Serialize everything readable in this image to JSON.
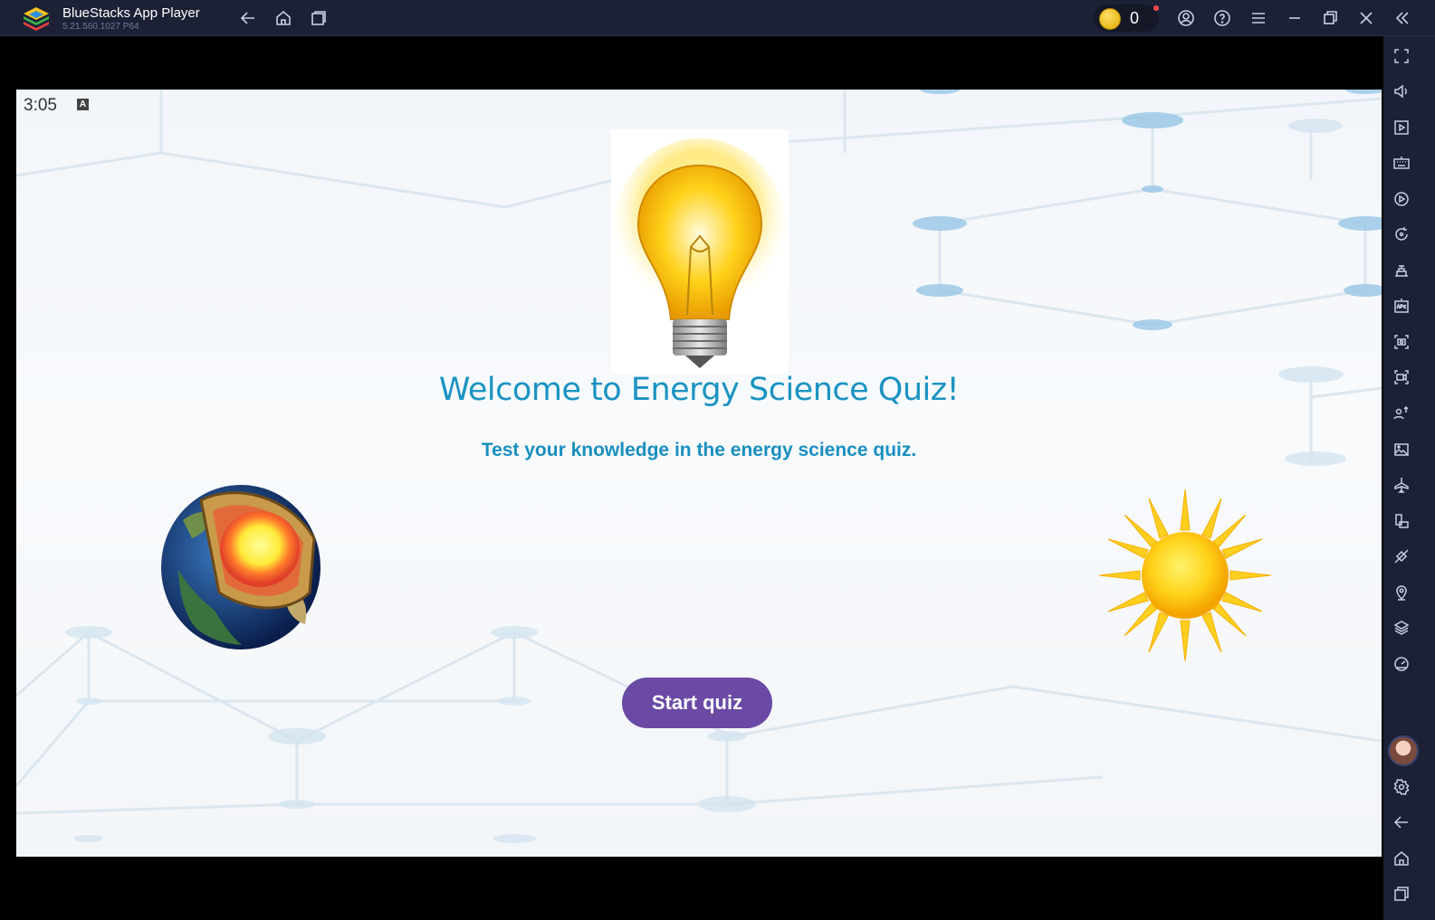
{
  "titlebar": {
    "app_name": "BlueStacks App Player",
    "version": "5.21.560.1027  P64",
    "coin_count": "0",
    "icons": [
      "back-icon",
      "home-icon",
      "multi-instance-icon",
      "account-icon",
      "help-icon",
      "menu-icon",
      "minimize-icon",
      "restore-icon",
      "close-icon",
      "collapse-sidebar-icon"
    ]
  },
  "sidebar": {
    "icons": [
      "fullscreen-icon",
      "volume-icon",
      "media-manager-icon",
      "keyboard-icon",
      "macro-icon",
      "rotate-icon",
      "game-controls-icon",
      "install-apk-icon",
      "screenshot-icon",
      "record-icon",
      "multi-instance-manager-icon",
      "gallery-icon",
      "airplane-mode-icon",
      "device-icon",
      "eco-mode-icon",
      "location-icon",
      "layers-icon",
      "performance-icon",
      "avatar",
      "settings-icon",
      "back-icon",
      "home-icon",
      "recent-apps-icon"
    ]
  },
  "android": {
    "status_time": "3:05",
    "status_indicator": "A"
  },
  "app": {
    "title": "Welcome to Energy Science Quiz!",
    "subtitle": "Test your knowledge in the energy science quiz.",
    "start_button": "Start quiz"
  },
  "colors": {
    "title": "#1a93c2",
    "button": "#6a4aa5",
    "chrome": "#1c2136"
  }
}
